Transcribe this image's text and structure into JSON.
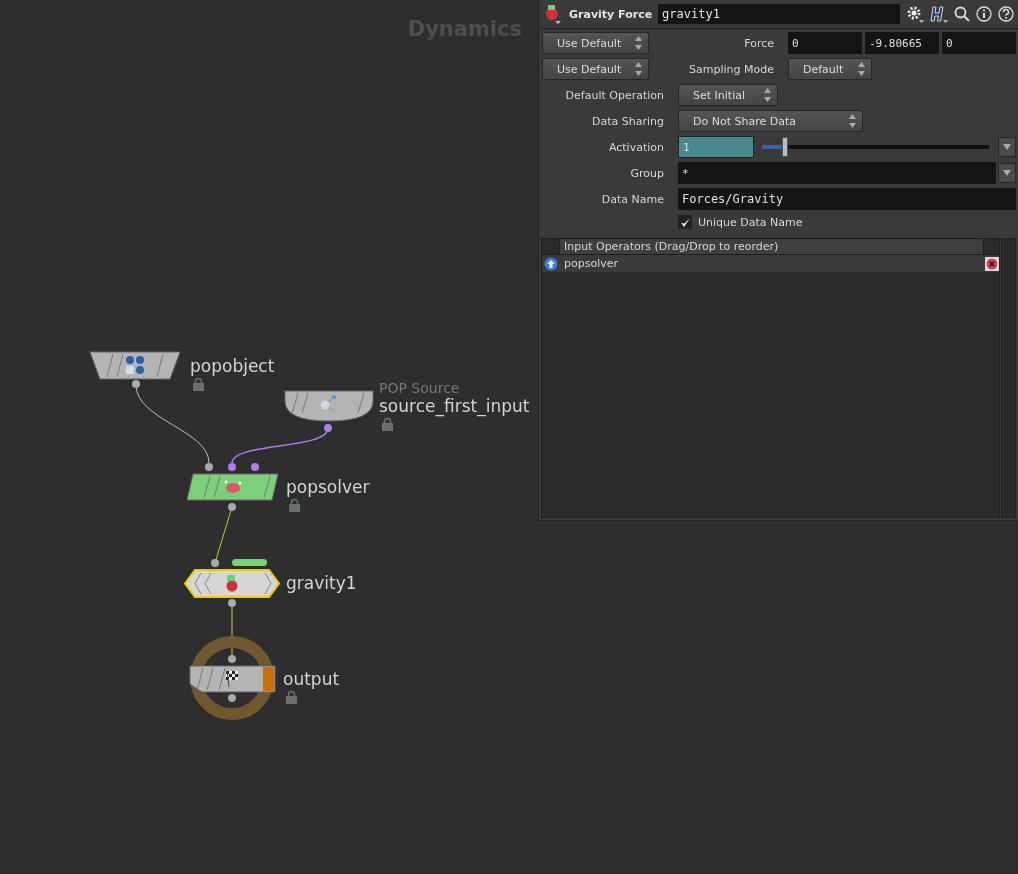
{
  "network": {
    "context_label": "Dynamics",
    "nodes": [
      {
        "kind": "object",
        "name": "popobject",
        "selected": false,
        "locked": true,
        "display": false
      },
      {
        "kind": "source",
        "subtitle": "POP Source",
        "name": "source_first_input",
        "selected": false,
        "locked": true,
        "display": false
      },
      {
        "kind": "solver",
        "name": "popsolver",
        "selected": false,
        "locked": true,
        "display": false
      },
      {
        "kind": "force",
        "name": "gravity1",
        "selected": true,
        "locked": false,
        "display": false
      },
      {
        "kind": "output",
        "name": "output",
        "selected": false,
        "locked": true,
        "display": true
      }
    ]
  },
  "parameters": {
    "node_type": "Gravity Force",
    "node_name": "gravity1",
    "rows": [
      {
        "kind": "vector",
        "menu": "Use Default",
        "label": "Force",
        "values": [
          "0",
          "-9.80665",
          "0"
        ]
      },
      {
        "kind": "menu_pair",
        "menu": "Use Default",
        "label": "Sampling Mode",
        "value": "Default"
      },
      {
        "kind": "menu",
        "label": "Default Operation",
        "value": "Set Initial"
      },
      {
        "kind": "menu",
        "label": "Data Sharing",
        "value": "Do Not Share Data"
      },
      {
        "kind": "slider",
        "label": "Activation",
        "value": "1",
        "level": 0.1
      },
      {
        "kind": "text_menu",
        "label": "Group",
        "value": "*"
      },
      {
        "kind": "text",
        "label": "Data Name",
        "value": "Forces/Gravity"
      },
      {
        "kind": "toggle",
        "label": "Unique Data Name",
        "checked": true
      }
    ],
    "input_operators": {
      "header": "Input Operators (Drag/Drop to reorder)",
      "items": [
        {
          "name": "popsolver"
        }
      ]
    }
  }
}
